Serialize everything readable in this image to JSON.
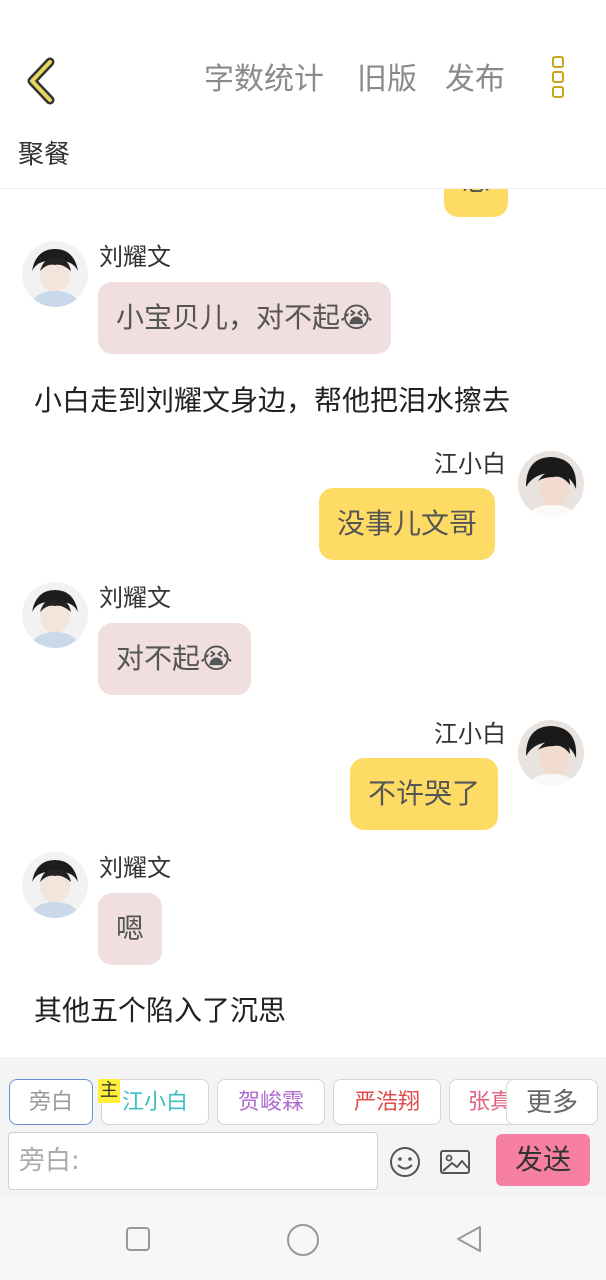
{
  "header": {
    "links": [
      "字数统计",
      "旧版",
      "发布"
    ],
    "title": "聚餐"
  },
  "messages": [
    {
      "type": "clipped-right",
      "text": "思"
    },
    {
      "type": "left",
      "name": "刘耀文",
      "text": "小宝贝儿，对不起😭"
    },
    {
      "type": "narration",
      "text": "小白走到刘耀文身边，帮他把泪水擦去"
    },
    {
      "type": "right",
      "name": "江小白",
      "text": "没事儿文哥"
    },
    {
      "type": "left",
      "name": "刘耀文",
      "text": "对不起😭"
    },
    {
      "type": "right",
      "name": "江小白",
      "text": "不许哭了"
    },
    {
      "type": "left",
      "name": "刘耀文",
      "text": "嗯"
    },
    {
      "type": "narration",
      "text": "其他五个陷入了沉思"
    }
  ],
  "chips": [
    {
      "label": "旁白",
      "color": "#999999"
    },
    {
      "label": "江小白",
      "color": "#3bbfbf"
    },
    {
      "label": "贺峻霖",
      "color": "#b06cd0"
    },
    {
      "label": "严浩翔",
      "color": "#e04c4c"
    },
    {
      "label": "张真",
      "color": "#e0607e"
    }
  ],
  "main_tag": "主",
  "more_label": "更多",
  "input": {
    "placeholder": "旁白:"
  },
  "send_label": "发送",
  "colors": {
    "pink_bubble": "#f1dfe0",
    "yellow_bubble": "#fddb64",
    "send": "#f77fa2",
    "accent": "#c9a51c"
  }
}
